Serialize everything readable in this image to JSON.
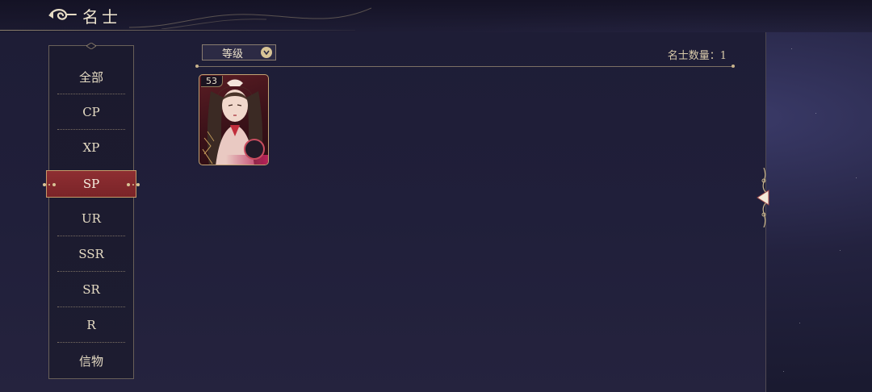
{
  "header": {
    "title": "名士"
  },
  "sidebar": {
    "items": [
      {
        "label": "全部",
        "active": false
      },
      {
        "label": "CP",
        "active": false
      },
      {
        "label": "XP",
        "active": false
      },
      {
        "label": "SP",
        "active": true
      },
      {
        "label": "UR",
        "active": false
      },
      {
        "label": "SSR",
        "active": false
      },
      {
        "label": "SR",
        "active": false
      },
      {
        "label": "R",
        "active": false
      },
      {
        "label": "信物",
        "active": false
      }
    ]
  },
  "filter": {
    "sort_label": "等级",
    "count_label": "名士数量：",
    "count_value": "1"
  },
  "cards": [
    {
      "level": "53",
      "portrait": "character-portrait"
    }
  ],
  "icons": {
    "back": "back-swirl-icon",
    "sort": "chevron-down-icon",
    "side": "expand-arrow-icon"
  },
  "colors": {
    "accent_gold": "#d8c496",
    "active_red": "#8e2e32",
    "background": "#1e1d36"
  }
}
